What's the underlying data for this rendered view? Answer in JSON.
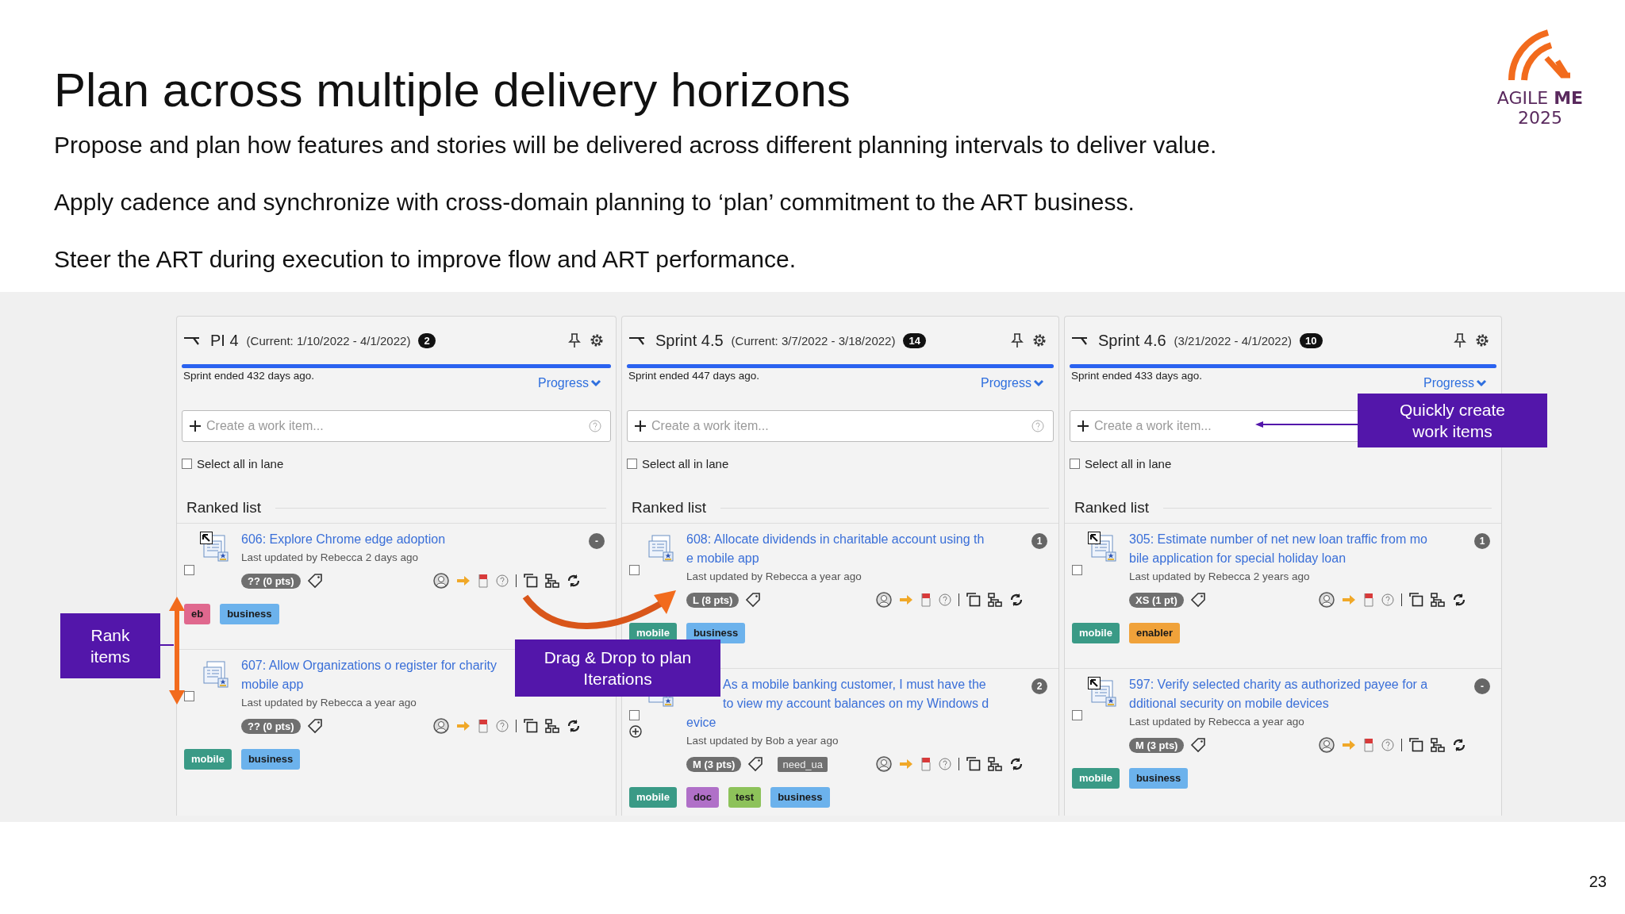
{
  "slide": {
    "title": "Plan across multiple delivery horizons",
    "paragraphs": [
      "Propose and plan how features and stories will be delivered across different planning intervals to deliver value.",
      "Apply cadence and synchronize with cross-domain planning to ‘plan’ commitment to the ART business.",
      "Steer the ART during execution to improve flow and ART performance."
    ],
    "logo": {
      "name": "AGILE **ME**",
      "year": "2025"
    },
    "page_number": "23"
  },
  "lanes": [
    {
      "name": "PI 4",
      "dates": "(Current: 1/10/2022 - 4/1/2022)",
      "count": "2",
      "timeline": {
        "level": 1,
        "text": "Sprint ended 432 days ago."
      },
      "progress_link": "Progress",
      "create": {
        "placeholder": "Create a work item..."
      },
      "select_all": {
        "label": "Select all in lane",
        "checked": false
      },
      "section": "Ranked list",
      "items": [
        {
          "rank_marker": true,
          "has_children": false,
          "checked": false,
          "title_lines": [
            "606: Explore Chrome edge adoption"
          ],
          "badge": "-",
          "updated": "Last updated by Rebecca 2 days ago",
          "size": "?? (0 pts)",
          "tags": [
            {
              "text": "eb",
              "color": "#e0688e"
            },
            {
              "text": "business",
              "color": "#6cb2ec"
            }
          ]
        },
        {
          "rank_marker": false,
          "has_children": false,
          "checked": false,
          "title_lines": [
            "607: Allow Organizations o register for charity",
            "mobile app"
          ],
          "updated": "Last updated by Rebecca a year ago",
          "size": "?? (0 pts)",
          "tags": [
            {
              "text": "mobile",
              "color": "#3a9a86"
            },
            {
              "text": "business",
              "color": "#6cb2ec"
            }
          ]
        }
      ]
    },
    {
      "name": "Sprint 4.5",
      "dates": "(Current: 3/7/2022 - 3/18/2022)",
      "count": "14",
      "timeline": {
        "level": 1,
        "text": "Sprint ended 447 days ago."
      },
      "progress_link": "Progress",
      "create": {
        "placeholder": "Create a work item..."
      },
      "select_all": {
        "label": "Select all in lane",
        "checked": false
      },
      "section": "Ranked list",
      "items": [
        {
          "rank_marker": false,
          "has_children": false,
          "checked": false,
          "title_lines": [
            "608: Allocate dividends in charitable account using th",
            "e mobile app"
          ],
          "badge": "1",
          "updated": "Last updated by Rebecca a year ago",
          "size": "L (8 pts)",
          "tags": [
            {
              "text": "mobile",
              "color": "#3a9a86"
            },
            {
              "text": "business",
              "color": "#6cb2ec"
            }
          ]
        },
        {
          "rank_marker": false,
          "has_children": true,
          "checked": false,
          "title_lines": [
            "As a mobile banking customer, I must have the",
            "to view my account balances on my Windows d",
            "evice"
          ],
          "badge": "2",
          "updated": "Last updated by Bob a year ago",
          "size": "M (3 pts)",
          "label": "need_ua",
          "tags": [
            {
              "text": "mobile",
              "color": "#3a9a86"
            },
            {
              "text": "doc",
              "color": "#b070c8"
            },
            {
              "text": "test",
              "color": "#8dc25a"
            },
            {
              "text": "business",
              "color": "#6cb2ec"
            }
          ]
        }
      ]
    },
    {
      "name": "Sprint 4.6",
      "dates": "(3/21/2022 - 4/1/2022)",
      "count": "10",
      "timeline": {
        "level": 1,
        "text": "Sprint ended 433 days ago."
      },
      "progress_link": "Progress",
      "create": {
        "placeholder": "Create a work item..."
      },
      "select_all": {
        "label": "Select all in lane",
        "checked": false
      },
      "section": "Ranked list",
      "items": [
        {
          "rank_marker": true,
          "has_children": false,
          "checked": false,
          "title_lines": [
            "305: Estimate number of net new loan traffic from mo",
            "bile application for special holiday loan"
          ],
          "badge": "1",
          "updated": "Last updated by Rebecca 2 years ago",
          "size": "XS (1 pt)",
          "tags": [
            {
              "text": "mobile",
              "color": "#3a9a86"
            },
            {
              "text": "enabler",
              "color": "#f0a23a"
            }
          ]
        },
        {
          "rank_marker": true,
          "has_children": false,
          "checked": false,
          "title_lines": [
            "597: Verify selected charity as authorized payee for a",
            "dditional security on mobile devices"
          ],
          "badge": "-",
          "updated": "Last updated by Rebecca a year ago",
          "size": "M (3 pts)",
          "tags": [
            {
              "text": "mobile",
              "color": "#3a9a86"
            },
            {
              "text": "business",
              "color": "#6cb2ec"
            }
          ]
        }
      ]
    }
  ],
  "callouts": [
    {
      "kind": "rank",
      "text": "Rank items"
    },
    {
      "kind": "drag",
      "text": "Drag & Drop to plan Iterations"
    },
    {
      "kind": "create",
      "text": "Quickly create work items"
    }
  ]
}
